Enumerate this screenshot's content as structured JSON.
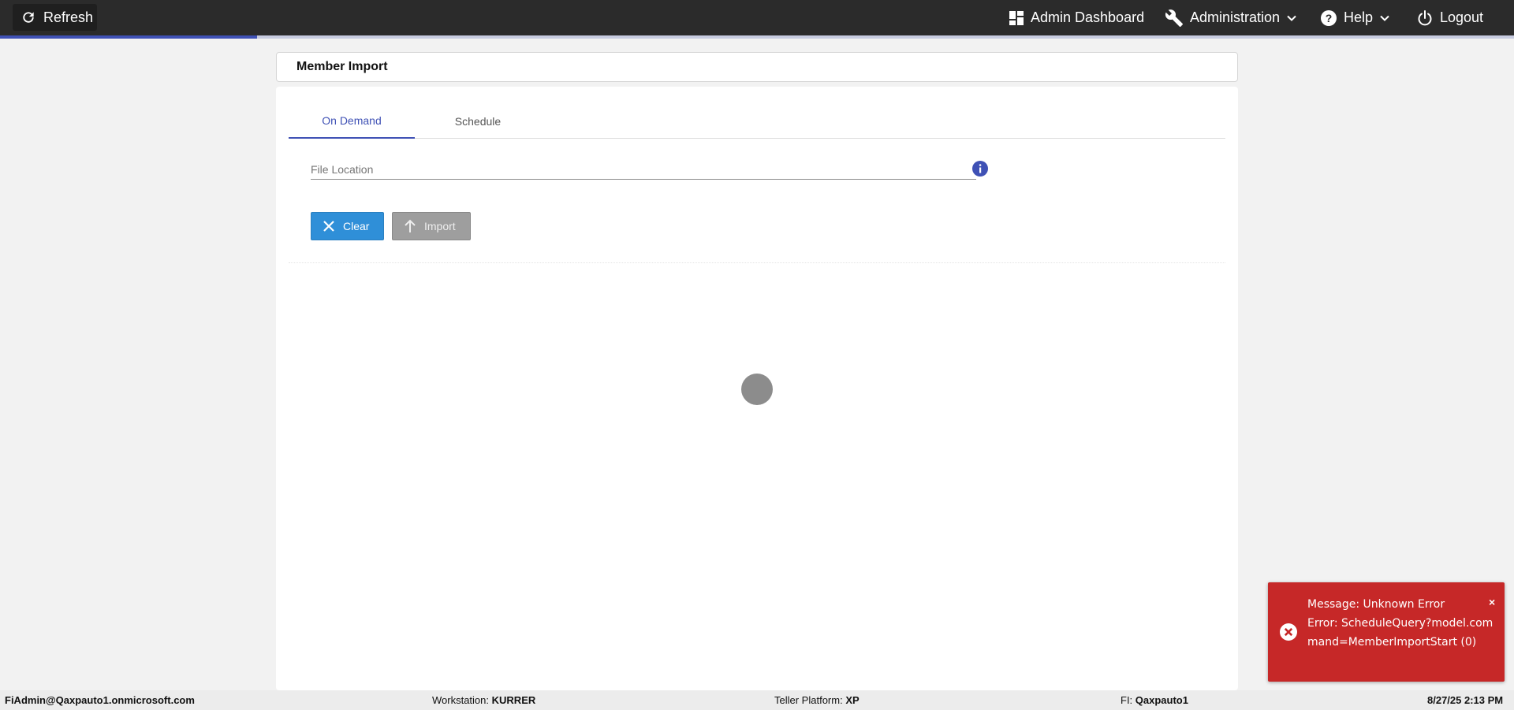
{
  "topbar": {
    "refresh_label": "Refresh",
    "nav": {
      "dashboard_label": "Admin Dashboard",
      "administration_label": "Administration",
      "help_label": "Help",
      "logout_label": "Logout"
    },
    "progress_fraction": 0.17
  },
  "page": {
    "title": "Member Import"
  },
  "tabs": [
    {
      "label": "On Demand",
      "active": true
    },
    {
      "label": "Schedule",
      "active": false
    }
  ],
  "form": {
    "file_location_placeholder": "File Location",
    "file_location_value": "",
    "clear_label": "Clear",
    "import_label": "Import"
  },
  "toast": {
    "type": "error",
    "message_line1": "Message: Unknown Error",
    "message_line2": "Error: ScheduleQuery?model.command=MemberImportStart (0)",
    "close_glyph": "×"
  },
  "statusbar": {
    "user": "FiAdmin@Qaxpauto1.onmicrosoft.com",
    "workstation_label": "Workstation:",
    "workstation_value": "KURRER",
    "platform_label": "Teller Platform:",
    "platform_value": "XP",
    "fi_label": "FI:",
    "fi_value": "Qaxpauto1",
    "datetime": "8/27/25 2:13 PM"
  },
  "colors": {
    "topbar_bg": "#2b2b2b",
    "accent": "#3f51b5",
    "clear_button": "#2f8fd8",
    "import_button_disabled": "#9e9e9e",
    "toast_error": "#c62828"
  },
  "icons": {
    "refresh": "refresh-icon",
    "dashboard": "dashboard-icon",
    "administration": "wrench-icon",
    "help": "help-circle-icon",
    "logout": "power-icon",
    "info": "info-icon",
    "clear": "close-icon",
    "import": "arrow-up-icon",
    "toast": "error-circle-icon"
  }
}
